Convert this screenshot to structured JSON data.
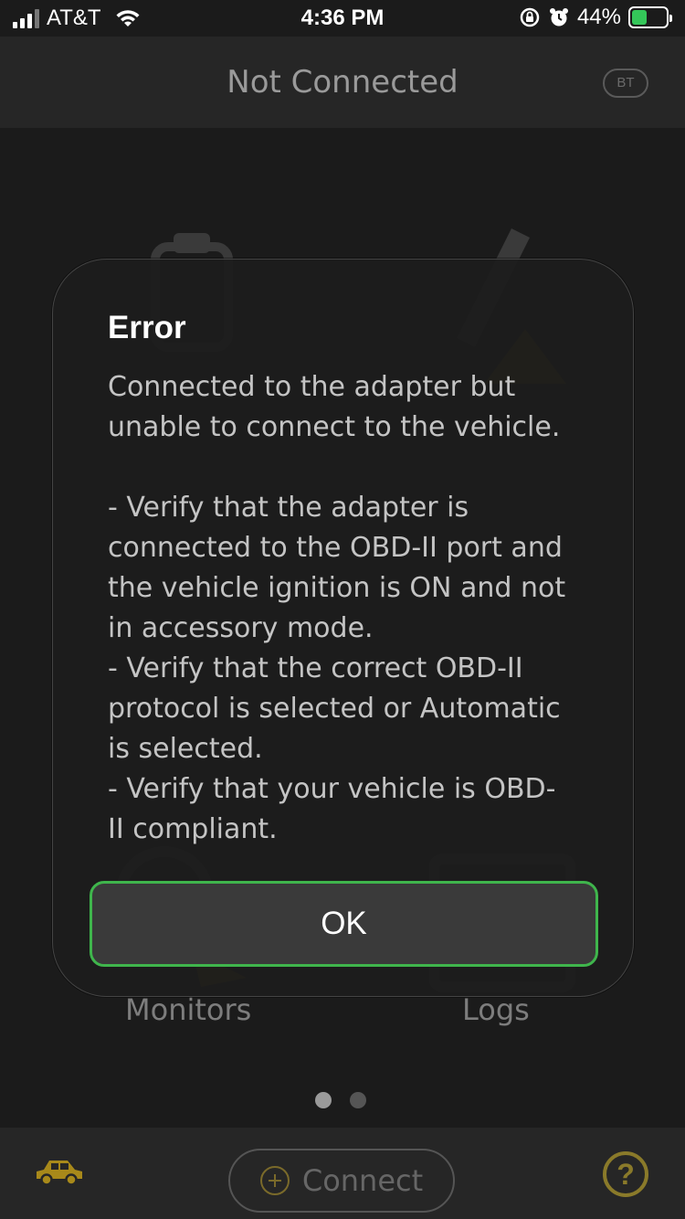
{
  "status_bar": {
    "carrier": "AT&T",
    "time": "4:36 PM",
    "battery_percent": "44%",
    "battery_level": 0.44,
    "icons": [
      "cellular-signal-icon",
      "wifi-icon",
      "orientation-lock-icon",
      "alarm-icon",
      "battery-charging-icon"
    ]
  },
  "nav": {
    "title": "Not Connected",
    "bt_label": "BT"
  },
  "background": {
    "tiles": [
      {
        "label": "Monitors",
        "icon": "monitors-icon"
      },
      {
        "label": "Logs",
        "icon": "logs-icon"
      }
    ],
    "page_count": 2,
    "active_page": 0
  },
  "bottom_bar": {
    "connect_label": "Connect",
    "help_label": "?"
  },
  "dialog": {
    "title": "Error",
    "message_lines": [
      "Connected to the adapter but",
      "unable to connect to the vehicle.",
      "",
      "- Verify that the adapter is",
      "connected to the OBD-II port and",
      "the vehicle ignition is ON and not",
      "in accessory mode.",
      "- Verify that the correct OBD-II",
      "protocol is selected or Automatic",
      "is selected.",
      "- Verify that your vehicle is OBD-",
      "II compliant."
    ],
    "ok_label": "OK"
  },
  "colors": {
    "accent_green": "#3fb54c",
    "accent_gold": "#c9a318",
    "battery_green": "#34c759"
  }
}
